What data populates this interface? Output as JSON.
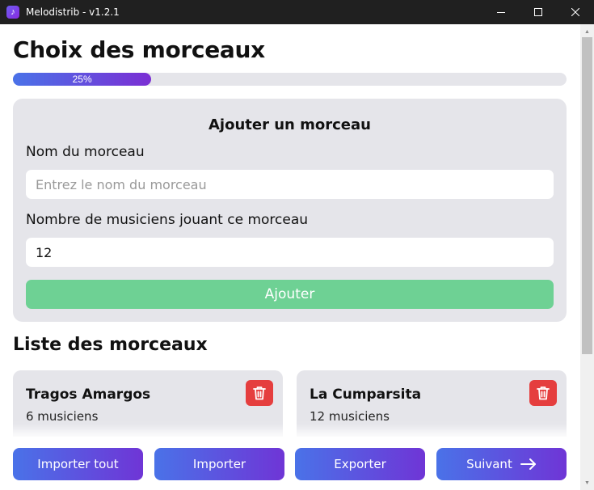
{
  "window": {
    "title": "Melodistrib - v1.2.1",
    "app_icon": "music-note-icon",
    "controls": [
      "minimize-icon",
      "maximize-icon",
      "close-icon"
    ]
  },
  "page": {
    "title": "Choix des morceaux",
    "progress": {
      "value": 0.25,
      "label": "25%"
    }
  },
  "add_form": {
    "title": "Ajouter un morceau",
    "name_label": "Nom du morceau",
    "name_placeholder": "Entrez le nom du morceau",
    "name_value": "",
    "musicians_label": "Nombre de musiciens jouant ce morceau",
    "musicians_value": "12",
    "submit_label": "Ajouter",
    "submit_color": "#6ed194"
  },
  "list": {
    "title": "Liste des morceaux",
    "items": [
      {
        "name": "Tragos Amargos",
        "count": "6 musiciens",
        "delete_icon": "trash-icon"
      },
      {
        "name": "La Cumparsita",
        "count": "12 musiciens",
        "delete_icon": "trash-icon"
      }
    ]
  },
  "footer": {
    "buttons": [
      {
        "label": "Importer tout"
      },
      {
        "label": "Importer"
      },
      {
        "label": "Exporter"
      },
      {
        "label": "Suivant",
        "icon": "arrow-right-icon"
      }
    ]
  },
  "colors": {
    "accent_start": "#4a72e8",
    "accent_end": "#7b2fd4",
    "danger": "#e53e3e",
    "success": "#6ed194"
  }
}
